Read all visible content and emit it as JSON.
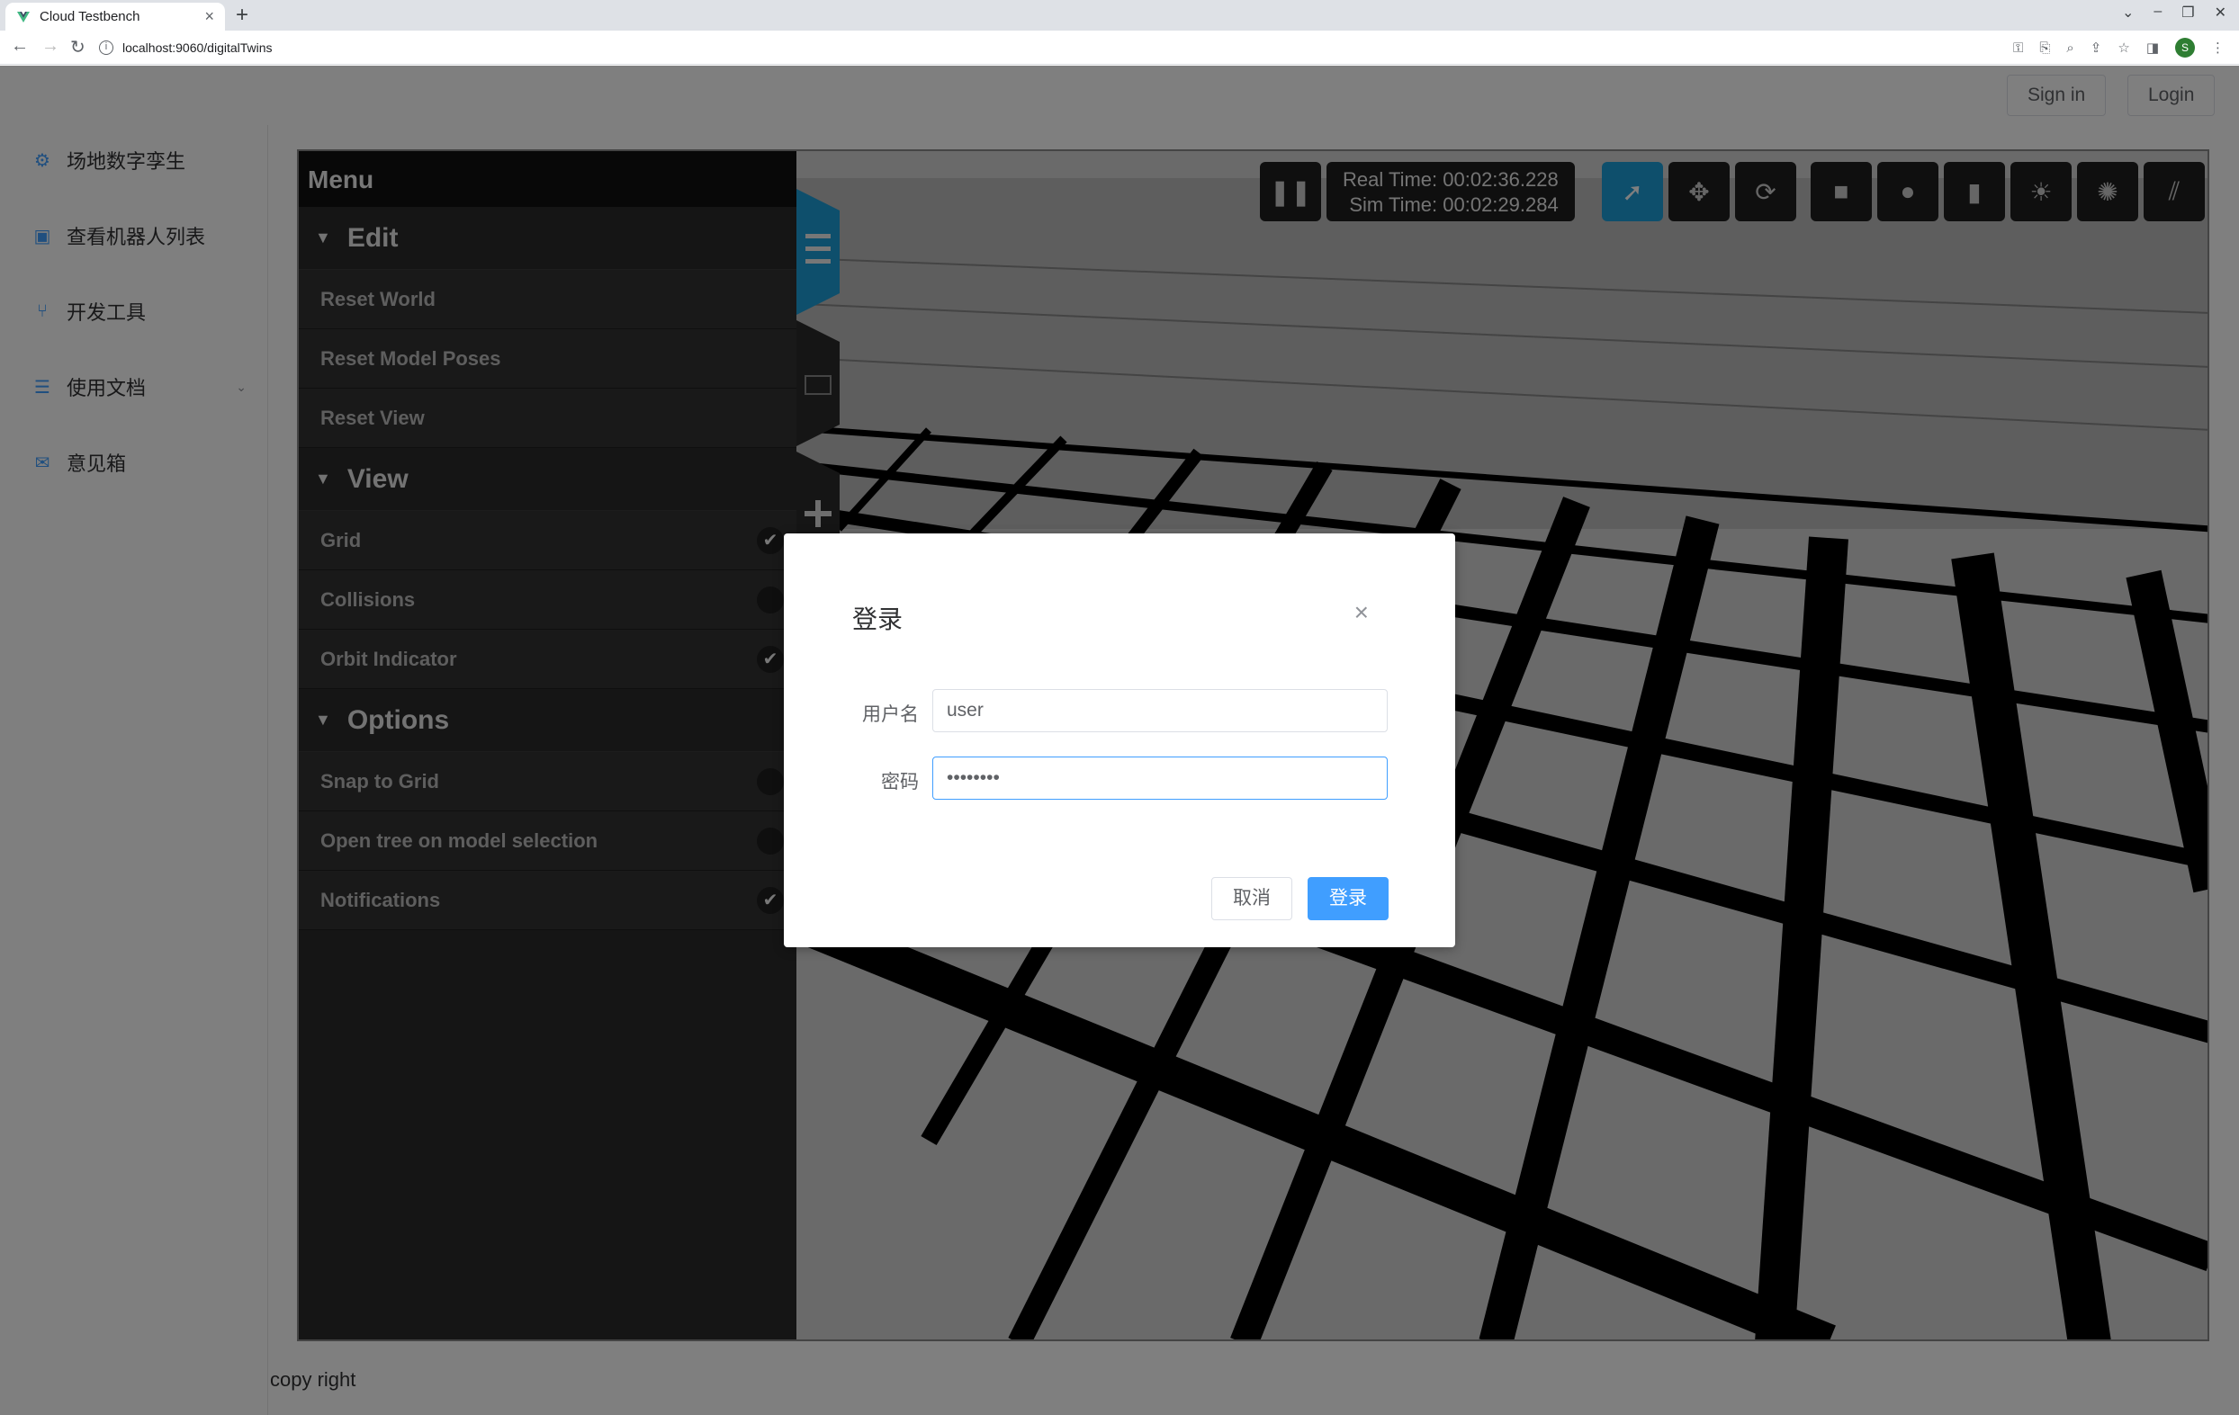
{
  "browser": {
    "tab_title": "Cloud Testbench",
    "new_tab": "+",
    "url": "localhost:9060/digitalTwins",
    "profile_initial": "S"
  },
  "header": {
    "sign_in": "Sign in",
    "login": "Login"
  },
  "sidebar": {
    "items": [
      {
        "label": "场地数字孪生",
        "icon": "digital-twin-icon"
      },
      {
        "label": "查看机器人列表",
        "icon": "robot-list-icon"
      },
      {
        "label": "开发工具",
        "icon": "tools-icon"
      },
      {
        "label": "使用文档",
        "icon": "docs-icon"
      },
      {
        "label": "意见箱",
        "icon": "feedback-icon"
      }
    ]
  },
  "footer": {
    "text": "copy right"
  },
  "gazebo": {
    "menu_title": "Menu",
    "sections": [
      {
        "title": "Edit",
        "items": [
          {
            "label": "Reset World"
          },
          {
            "label": "Reset Model Poses"
          },
          {
            "label": "Reset View"
          }
        ]
      },
      {
        "title": "View",
        "items": [
          {
            "label": "Grid",
            "checked": true
          },
          {
            "label": "Collisions",
            "checked": false
          },
          {
            "label": "Orbit Indicator",
            "checked": true
          }
        ]
      },
      {
        "title": "Options",
        "items": [
          {
            "label": "Snap to Grid",
            "checked": false
          },
          {
            "label": "Open tree on model selection",
            "checked": false
          },
          {
            "label": "Notifications",
            "checked": true
          }
        ]
      }
    ],
    "real_time": "Real Time: 00:02:36.228",
    "sim_time": "Sim Time: 00:02:29.284"
  },
  "dialog": {
    "title": "登录",
    "username_label": "用户名",
    "username_value": "user",
    "password_label": "密码",
    "password_value": "••••••••",
    "cancel": "取消",
    "ok": "登录"
  },
  "colors": {
    "primary": "#409eff",
    "gazebo_accent": "#1c9ed8"
  }
}
